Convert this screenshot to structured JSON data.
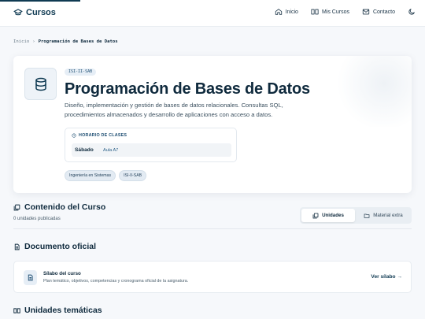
{
  "header": {
    "brand": "Cursos",
    "nav": [
      {
        "label": "Inicio",
        "icon": "home-icon"
      },
      {
        "label": "Mis Cursos",
        "icon": "book-open-icon"
      },
      {
        "label": "Contacto",
        "icon": "mail-icon"
      }
    ],
    "theme_icon": "moon-icon"
  },
  "breadcrumb": {
    "home": "Inicio",
    "separator": "›",
    "current": "Programación de Bases de Datos"
  },
  "course": {
    "code": "ISI-II-SAB",
    "title": "Programación de Bases de Datos",
    "description": "Diseño, implementación y gestión de bases de datos relacionales. Consultas SQL, procedimientos almacenados y desarrollo de aplicaciones con acceso a datos.",
    "icon": "database-icon",
    "schedule": {
      "heading": "HORARIO DE CLASES",
      "day": "Sábado",
      "room": "Aula A7"
    },
    "tags": [
      "Ingeniería en Sistemas",
      "ISI-II-SAB"
    ]
  },
  "content": {
    "title": "Contenido del Curso",
    "published": "0 unidades publicadas",
    "tabs": [
      {
        "label": "Unidades",
        "active": true,
        "icon": "layers-icon"
      },
      {
        "label": "Material extra",
        "active": false,
        "icon": "folder-icon"
      }
    ]
  },
  "official_doc": {
    "title": "Documento oficial",
    "card_title": "Sílabo del curso",
    "card_desc": "Plan temático, objetivos, competencias y cronograma oficial de la asignatura.",
    "link": "Ver sílabo →"
  },
  "units": {
    "title": "Unidades temáticas"
  },
  "colors": {
    "primary": "#0f3a52",
    "background": "#f6f8fb",
    "pill": "#e6eef6"
  }
}
